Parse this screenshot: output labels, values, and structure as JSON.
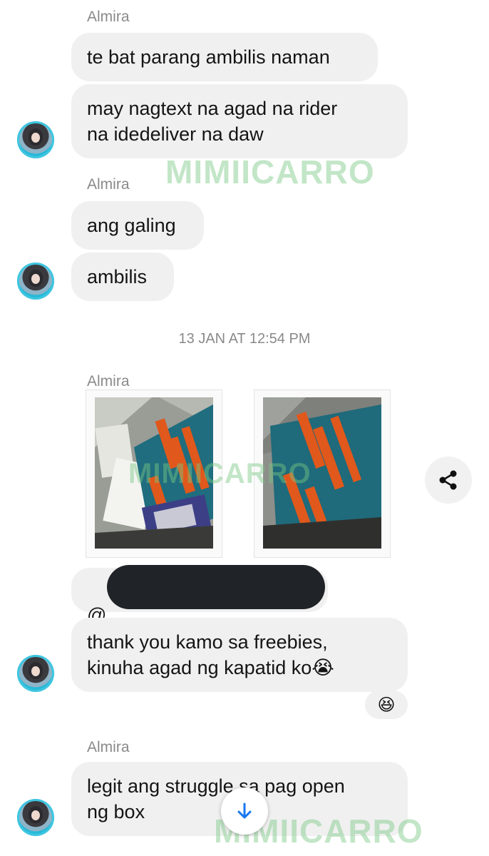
{
  "watermark": "MIMIICARRO",
  "messages": {
    "group1": {
      "sender": "Almira",
      "bubbles": [
        "te bat parang ambilis naman",
        "may nagtext na agad na rider\nna idedeliver na daw"
      ]
    },
    "group2": {
      "sender": "Almira",
      "bubbles": [
        "ang galing",
        "ambilis"
      ]
    },
    "timestamp": "13 JAN AT 12:54 PM",
    "group3": {
      "sender": "Almira",
      "mention_prefix": "@",
      "bubbles": [
        "thank you kamo sa freebies,\nkinuha agad ng kapatid ko😭"
      ],
      "reaction": "😆"
    },
    "group4": {
      "sender": "Almira",
      "bubbles": [
        "legit ang struggle sa pag open\nng box"
      ]
    }
  },
  "icons": {
    "share": "share-icon",
    "scroll_down": "arrow-down-icon"
  },
  "colors": {
    "bubble": "#f0f0f0",
    "meta_text": "#8a8a8a",
    "accent": "#1877f2"
  }
}
